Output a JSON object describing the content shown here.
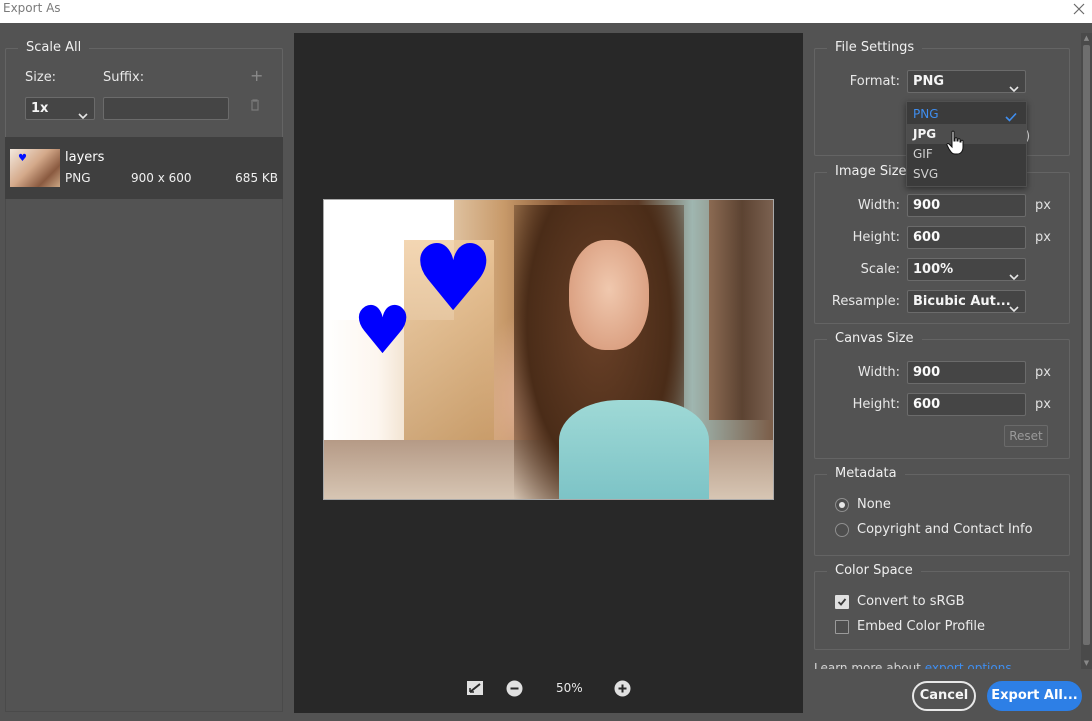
{
  "window": {
    "title": "Export As"
  },
  "left": {
    "scale_all_title": "Scale All",
    "size_label": "Size:",
    "suffix_label": "Suffix:",
    "size_value": "1x",
    "suffix_value": "",
    "asset": {
      "name": "layers",
      "format": "PNG",
      "dimensions": "900 x 600",
      "file_size": "685 KB"
    }
  },
  "preview": {
    "zoom": "50%"
  },
  "file_settings": {
    "title": "File Settings",
    "format_label": "Format:",
    "format_value": "PNG",
    "format_options": [
      "PNG",
      "JPG",
      "GIF",
      "SVG"
    ],
    "hidden_option_tail": "t)"
  },
  "image_size": {
    "title": "Image Size",
    "width_label": "Width:",
    "width_value": "900",
    "height_label": "Height:",
    "height_value": "600",
    "scale_label": "Scale:",
    "scale_value": "100%",
    "resample_label": "Resample:",
    "resample_value": "Bicubic Aut...",
    "unit": "px"
  },
  "canvas_size": {
    "title": "Canvas Size",
    "width_label": "Width:",
    "width_value": "900",
    "height_label": "Height:",
    "height_value": "600",
    "unit": "px",
    "reset_label": "Reset"
  },
  "metadata": {
    "title": "Metadata",
    "options": [
      "None",
      "Copyright and Contact Info"
    ],
    "selected": "None"
  },
  "color_space": {
    "title": "Color Space",
    "convert_label": "Convert to sRGB",
    "convert_checked": true,
    "embed_label": "Embed Color Profile",
    "embed_checked": false
  },
  "footer": {
    "learn_text": "Learn more about",
    "learn_link": "export options",
    "cancel_label": "Cancel",
    "export_label": "Export All..."
  },
  "colors": {
    "accent": "#2d7fe6",
    "link": "#3f8ef0",
    "heart": "#0000ff"
  }
}
